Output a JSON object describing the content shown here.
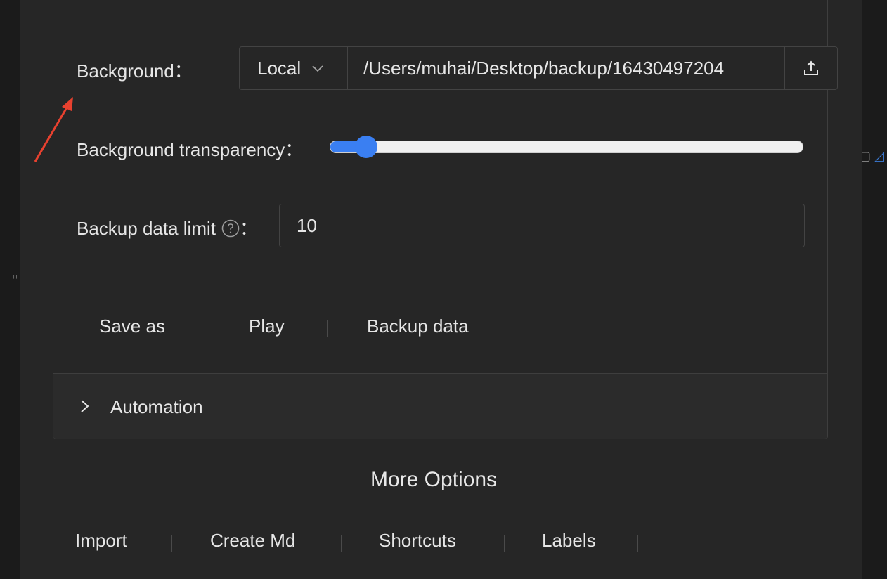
{
  "background_row": {
    "label": "Background：",
    "source_select": "Local",
    "path_value": "/Users/muhai/Desktop/backup/16430497204",
    "upload_icon": "upload-icon"
  },
  "transparency_row": {
    "label": "Background transparency：",
    "value_fraction": 0.05
  },
  "backup_limit_row": {
    "label": "Backup data limit",
    "colon": "：",
    "value": "10",
    "help_icon": "question-circle-icon"
  },
  "actions": {
    "save_as": "Save as",
    "play": "Play",
    "backup_data": "Backup data"
  },
  "automation": {
    "title": "Automation"
  },
  "more_options": {
    "title": "More Options",
    "items": [
      "Import",
      "Create Md",
      "Shortcuts",
      "Labels"
    ]
  },
  "colors": {
    "accent": "#3a7ff2",
    "annotation_arrow": "#e8412f",
    "panel_bg": "#262626"
  }
}
